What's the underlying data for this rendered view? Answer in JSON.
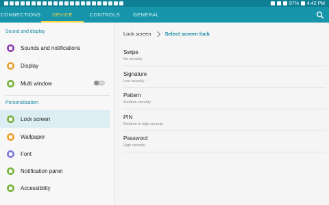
{
  "status_bar": {
    "battery": "97%",
    "time": "4:42 PM"
  },
  "tabs": [
    {
      "label": "CONNECTIONS",
      "active": false
    },
    {
      "label": "DEVICE",
      "active": true
    },
    {
      "label": "CONTROLS",
      "active": false
    },
    {
      "label": "GENERAL",
      "active": false
    }
  ],
  "sidebar": {
    "sections": [
      {
        "title": "Sound and display"
      },
      {
        "title": "Personalization"
      }
    ],
    "items": [
      {
        "label": "Sounds and notifications",
        "icon": "speaker-icon",
        "color": "#8e44ad"
      },
      {
        "label": "Display",
        "icon": "display-icon",
        "color": "#e6a23c"
      },
      {
        "label": "Multi window",
        "icon": "multi-window-icon",
        "color": "#7cb342",
        "toggle": "OFF"
      },
      {
        "label": "Lock screen",
        "icon": "lock-icon",
        "color": "#7cb342",
        "selected": true
      },
      {
        "label": "Wallpaper",
        "icon": "wallpaper-icon",
        "color": "#f0a030"
      },
      {
        "label": "Font",
        "icon": "font-icon",
        "color": "#7e7ed8"
      },
      {
        "label": "Notification panel",
        "icon": "notification-panel-icon",
        "color": "#7cb342"
      },
      {
        "label": "Accessibility",
        "icon": "accessibility-icon",
        "color": "#7cb342"
      }
    ]
  },
  "breadcrumb": {
    "parent": "Lock screen",
    "current": "Select screen lock"
  },
  "options": [
    {
      "title": "Swipe",
      "subtitle": "No security"
    },
    {
      "title": "Signature",
      "subtitle": "Low security"
    },
    {
      "title": "Pattern",
      "subtitle": "Medium security"
    },
    {
      "title": "PIN",
      "subtitle": "Medium to high security"
    },
    {
      "title": "Password",
      "subtitle": "High security"
    }
  ],
  "colors": {
    "status_bar": "#0f7f94",
    "tab_bar": "#1795aa",
    "tab_active": "#ffd54a",
    "accent": "#1a8aa3"
  }
}
